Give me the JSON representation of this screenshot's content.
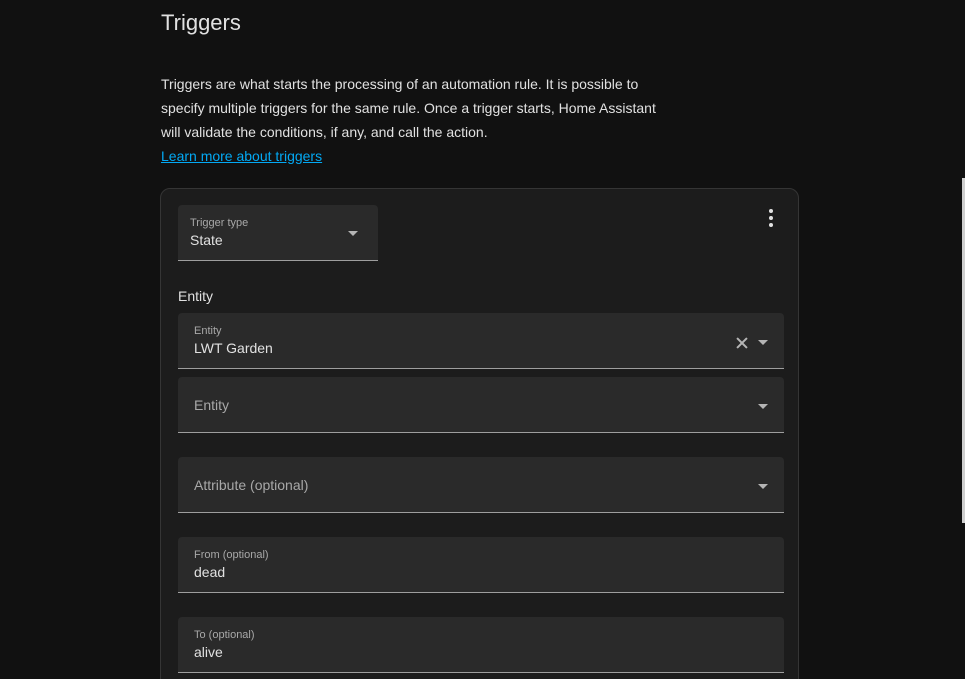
{
  "section": {
    "title": "Triggers",
    "description": "Triggers are what starts the processing of an automation rule. It is possible to specify multiple triggers for the same rule. Once a trigger starts, Home Assistant will validate the conditions, if any, and call the action.",
    "learn_more_link": "Learn more about triggers"
  },
  "trigger": {
    "type_label": "Trigger type",
    "type_value": "State",
    "menu_icon": "dots-vertical-icon",
    "entity_heading": "Entity",
    "entity_field": {
      "label": "Entity",
      "value": "LWT Garden"
    },
    "entity_add_field": {
      "placeholder": "Entity"
    },
    "attribute_field": {
      "placeholder": "Attribute (optional)"
    },
    "from_field": {
      "label": "From (optional)",
      "value": "dead"
    },
    "to_field": {
      "label": "To (optional)",
      "value": "alive"
    }
  },
  "colors": {
    "background": "#111111",
    "card": "#1c1c1c",
    "field": "#2a2a2a",
    "link": "#03a9f4",
    "text": "#e1e1e1",
    "secondary_text": "#a8a8a8"
  }
}
